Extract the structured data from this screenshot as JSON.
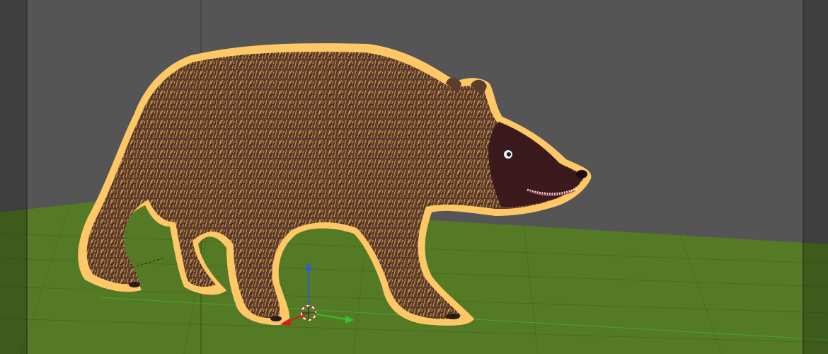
{
  "viewport": {
    "background": "#555555",
    "floor_color": "#557a25",
    "grid_color": "#4a6c1f",
    "selection_outline": "#ffc866"
  },
  "scene": {
    "object": "bear-mesh",
    "selected": true,
    "fur_color": "#6b4a3a",
    "face_color": "#3a1a1c"
  },
  "gizmo": {
    "type": "translate",
    "axes": [
      {
        "axis": "x",
        "color": "#d21d1d"
      },
      {
        "axis": "y",
        "color": "#2fc52f"
      },
      {
        "axis": "z",
        "color": "#2b5cd6"
      }
    ]
  }
}
